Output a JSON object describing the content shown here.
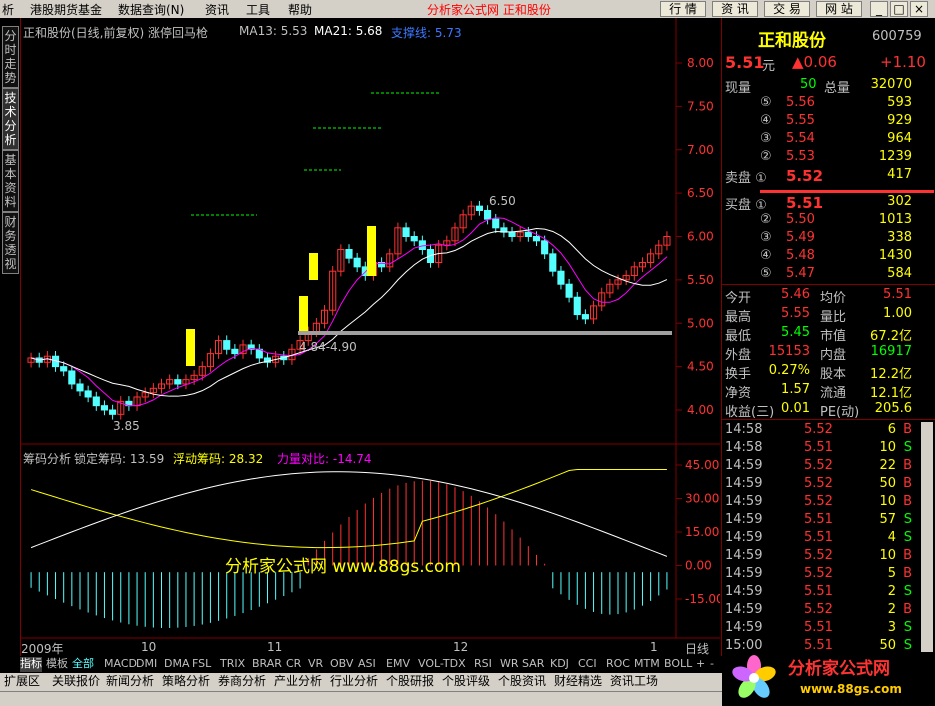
{
  "menu": {
    "items": [
      "析",
      "港股期货基金",
      "数据查询(N)",
      "资讯",
      "工具",
      "帮助"
    ],
    "brand": "分析家公式网 正和股份",
    "buttons": [
      "行 情",
      "资 讯",
      "交 易",
      "网 站"
    ]
  },
  "side_tabs": [
    "分时走势",
    "技术分析",
    "基本资料",
    "财务透视"
  ],
  "main": {
    "title": "正和股份(日线,前复权) 涨停回马枪",
    "ma13_label": "MA13: 5.53",
    "ma21_label": "MA21: 5.68",
    "support_label": "支撑线: 5.73",
    "price_axis": [
      "8.00",
      "7.50",
      "7.00",
      "6.50",
      "6.00",
      "5.50",
      "5.00",
      "4.50",
      "4.00"
    ],
    "annotations": {
      "high": "6.50",
      "low": "3.85",
      "range": "4.84-4.90"
    }
  },
  "indicator": {
    "name": "筹码分析",
    "lock_label": "锁定筹码: 13.59",
    "float_label": "浮动筹码: 28.32",
    "power_label": "力量对比: -14.74",
    "axis": [
      "45.00",
      "30.00",
      "15.00",
      "0.00",
      "-15.00"
    ],
    "watermark": "分析家公式网 www.88gs.com"
  },
  "date_axis": [
    "2009年",
    "10",
    "11",
    "12",
    "1"
  ],
  "period": "日线",
  "quote": {
    "name": "正和股份",
    "code": "600759",
    "price": "5.51",
    "unit": "元",
    "change": "▲0.06",
    "change_pct": "+1.10",
    "vol_now_label": "现量",
    "vol_now": "50",
    "vol_total_label": "总量",
    "vol_total": "32070",
    "sells": [
      {
        "l": "⑤",
        "p": "5.56",
        "v": "593"
      },
      {
        "l": "④",
        "p": "5.55",
        "v": "929"
      },
      {
        "l": "③",
        "p": "5.54",
        "v": "964"
      },
      {
        "l": "②",
        "p": "5.53",
        "v": "1239"
      },
      {
        "l": "卖盘 ①",
        "p": "5.52",
        "v": "417"
      }
    ],
    "buys": [
      {
        "l": "买盘 ①",
        "p": "5.51",
        "v": "302"
      },
      {
        "l": "②",
        "p": "5.50",
        "v": "1013"
      },
      {
        "l": "③",
        "p": "5.49",
        "v": "338"
      },
      {
        "l": "④",
        "p": "5.48",
        "v": "1430"
      },
      {
        "l": "⑤",
        "p": "5.47",
        "v": "584"
      }
    ],
    "stats": [
      [
        "今开",
        "5.46",
        "均价",
        "5.51"
      ],
      [
        "最高",
        "5.55",
        "量比",
        "1.00"
      ],
      [
        "最低",
        "5.45",
        "市值",
        "67.2亿"
      ],
      [
        "外盘",
        "15153",
        "内盘",
        "16917"
      ],
      [
        "换手",
        "0.27%",
        "股本",
        "12.2亿"
      ],
      [
        "净资",
        "1.57",
        "流通",
        "12.1亿"
      ],
      [
        "收益(三)",
        "0.01",
        "PE(动)",
        "205.6"
      ]
    ],
    "ticks": [
      [
        "14:58",
        "5.52",
        "6",
        "B"
      ],
      [
        "14:58",
        "5.51",
        "10",
        "S"
      ],
      [
        "14:59",
        "5.52",
        "22",
        "B"
      ],
      [
        "14:59",
        "5.52",
        "50",
        "B"
      ],
      [
        "14:59",
        "5.52",
        "10",
        "B"
      ],
      [
        "14:59",
        "5.51",
        "57",
        "S"
      ],
      [
        "14:59",
        "5.51",
        "4",
        "S"
      ],
      [
        "14:59",
        "5.52",
        "10",
        "B"
      ],
      [
        "14:59",
        "5.52",
        "5",
        "B"
      ],
      [
        "14:59",
        "5.51",
        "2",
        "S"
      ],
      [
        "14:59",
        "5.52",
        "2",
        "B"
      ],
      [
        "14:59",
        "5.51",
        "3",
        "S"
      ],
      [
        "15:00",
        "5.51",
        "50",
        "S"
      ]
    ]
  },
  "indicator_tabs": [
    "指标",
    "模板",
    "全部",
    "MACD",
    "DMI",
    "DMA",
    "FSL",
    "TRIX",
    "BRAR",
    "CR",
    "VR",
    "OBV",
    "ASI",
    "EMV",
    "VOL-TDX",
    "RSI",
    "WR",
    "SAR",
    "KDJ",
    "CCI",
    "ROC",
    "MTM",
    "BOLL",
    "+",
    "-"
  ],
  "bottom_tabs": [
    "扩展区",
    "关联报价",
    "新闻分析",
    "策略分析",
    "券商分析",
    "产业分析",
    "行业分析",
    "个股研报",
    "个股评级",
    "个股资讯",
    "财经精选",
    "资讯工场"
  ],
  "logo": {
    "text": "分析家公式网",
    "url": "www.88gs.com"
  },
  "colors": {
    "up": "#ff3232",
    "down": "#54ffff",
    "yellow": "#ffff00",
    "green": "#00ff00"
  }
}
